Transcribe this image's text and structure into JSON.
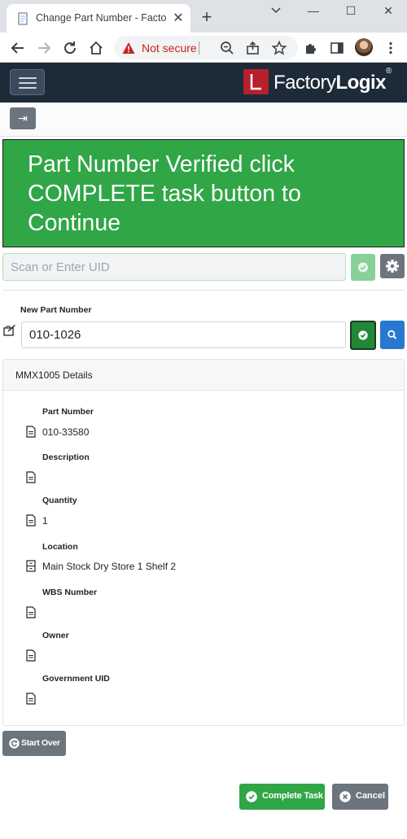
{
  "browser": {
    "tab_title": "Change Part Number - Factory",
    "tab_close": "✕",
    "new_tab": "+",
    "window_controls": {
      "minimize": "—",
      "maximize": "☐",
      "close": "✕"
    },
    "security_text": "Not secure",
    "warning_color": "#c5221f"
  },
  "app": {
    "brand_prefix": "Factory",
    "brand_suffix": "Logix",
    "brand_mark": "®",
    "header_color": "#1d2b39",
    "brand_color": "#b8202e"
  },
  "subbar": {
    "collapse_icon": "⇥"
  },
  "banner": {
    "message": "Part Number Verified click COMPLETE task button to Continue",
    "color": "#30a646"
  },
  "scan": {
    "placeholder": "Scan or Enter UID",
    "value": ""
  },
  "new_part": {
    "label": "New Part Number",
    "value": "010-1026"
  },
  "details": {
    "title": "MMX1005 Details",
    "fields": [
      {
        "label": "Part Number",
        "value": "010-33580",
        "icon": "document-icon"
      },
      {
        "label": "Description",
        "value": "",
        "icon": "document-icon"
      },
      {
        "label": "Quantity",
        "value": "1",
        "icon": "document-icon"
      },
      {
        "label": "Location",
        "value": "Main Stock Dry Store 1 Shelf 2",
        "icon": "cabinet-icon"
      },
      {
        "label": "WBS Number",
        "value": "",
        "icon": "document-icon"
      },
      {
        "label": "Owner",
        "value": "",
        "icon": "document-icon"
      },
      {
        "label": "Government UID",
        "value": "",
        "icon": "document-icon"
      }
    ]
  },
  "actions": {
    "start_over": "Start Over",
    "complete": "Complete Task",
    "cancel": "Cancel"
  }
}
